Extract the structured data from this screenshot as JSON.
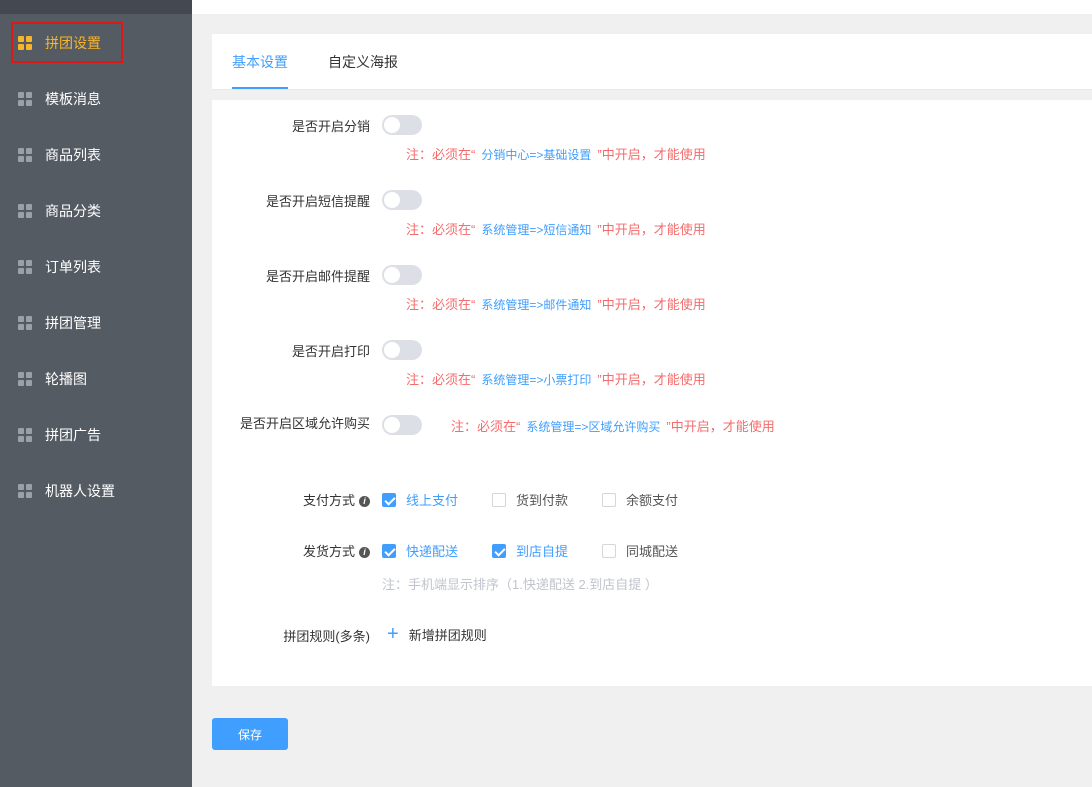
{
  "sidebar": {
    "items": [
      {
        "label": "拼团设置",
        "active": true
      },
      {
        "label": "模板消息"
      },
      {
        "label": "商品列表"
      },
      {
        "label": "商品分类"
      },
      {
        "label": "订单列表"
      },
      {
        "label": "拼团管理"
      },
      {
        "label": "轮播图"
      },
      {
        "label": "拼团广告"
      },
      {
        "label": "机器人设置"
      }
    ]
  },
  "tabs": [
    {
      "label": "基本设置",
      "active": true
    },
    {
      "label": "自定义海报"
    }
  ],
  "form": {
    "distribution": {
      "label": "是否开启分销",
      "enabled": false,
      "note_prefix": "注：必须在“",
      "note_path": "分销中心=>基础设置",
      "note_suffix": "”中开启，才能使用"
    },
    "sms": {
      "label": "是否开启短信提醒",
      "enabled": false,
      "note_prefix": "注：必须在“",
      "note_path": "系统管理=>短信通知",
      "note_suffix": "”中开启，才能使用"
    },
    "email": {
      "label": "是否开启邮件提醒",
      "enabled": false,
      "note_prefix": "注：必须在“",
      "note_path": "系统管理=>邮件通知",
      "note_suffix": "”中开启，才能使用"
    },
    "print": {
      "label": "是否开启打印",
      "enabled": false,
      "note_prefix": "注：必须在“",
      "note_path": "系统管理=>小票打印",
      "note_suffix": "”中开启，才能使用"
    },
    "region": {
      "label": "是否开启区域允许购买",
      "enabled": false,
      "note_prefix": "注：必须在“",
      "note_path": "系统管理=>区域允许购买",
      "note_suffix": "”中开启，才能使用"
    },
    "payment": {
      "label": "支付方式",
      "options": [
        {
          "label": "线上支付",
          "checked": true
        },
        {
          "label": "货到付款",
          "checked": false
        },
        {
          "label": "余额支付",
          "checked": false
        }
      ]
    },
    "delivery": {
      "label": "发货方式",
      "options": [
        {
          "label": "快递配送",
          "checked": true
        },
        {
          "label": "到店自提",
          "checked": true
        },
        {
          "label": "同城配送",
          "checked": false
        }
      ],
      "hint": "注：手机端显示排序（1.快递配送 2.到店自提 ）"
    },
    "rules": {
      "label": "拼团规则(多条)",
      "add_label": "新增拼团规则"
    }
  },
  "actions": {
    "save_label": "保存"
  },
  "colors": {
    "accent": "#409eff",
    "warning": "#f56c6c",
    "active_menu": "#f7b52c",
    "sidebar_bg": "#545b63"
  }
}
